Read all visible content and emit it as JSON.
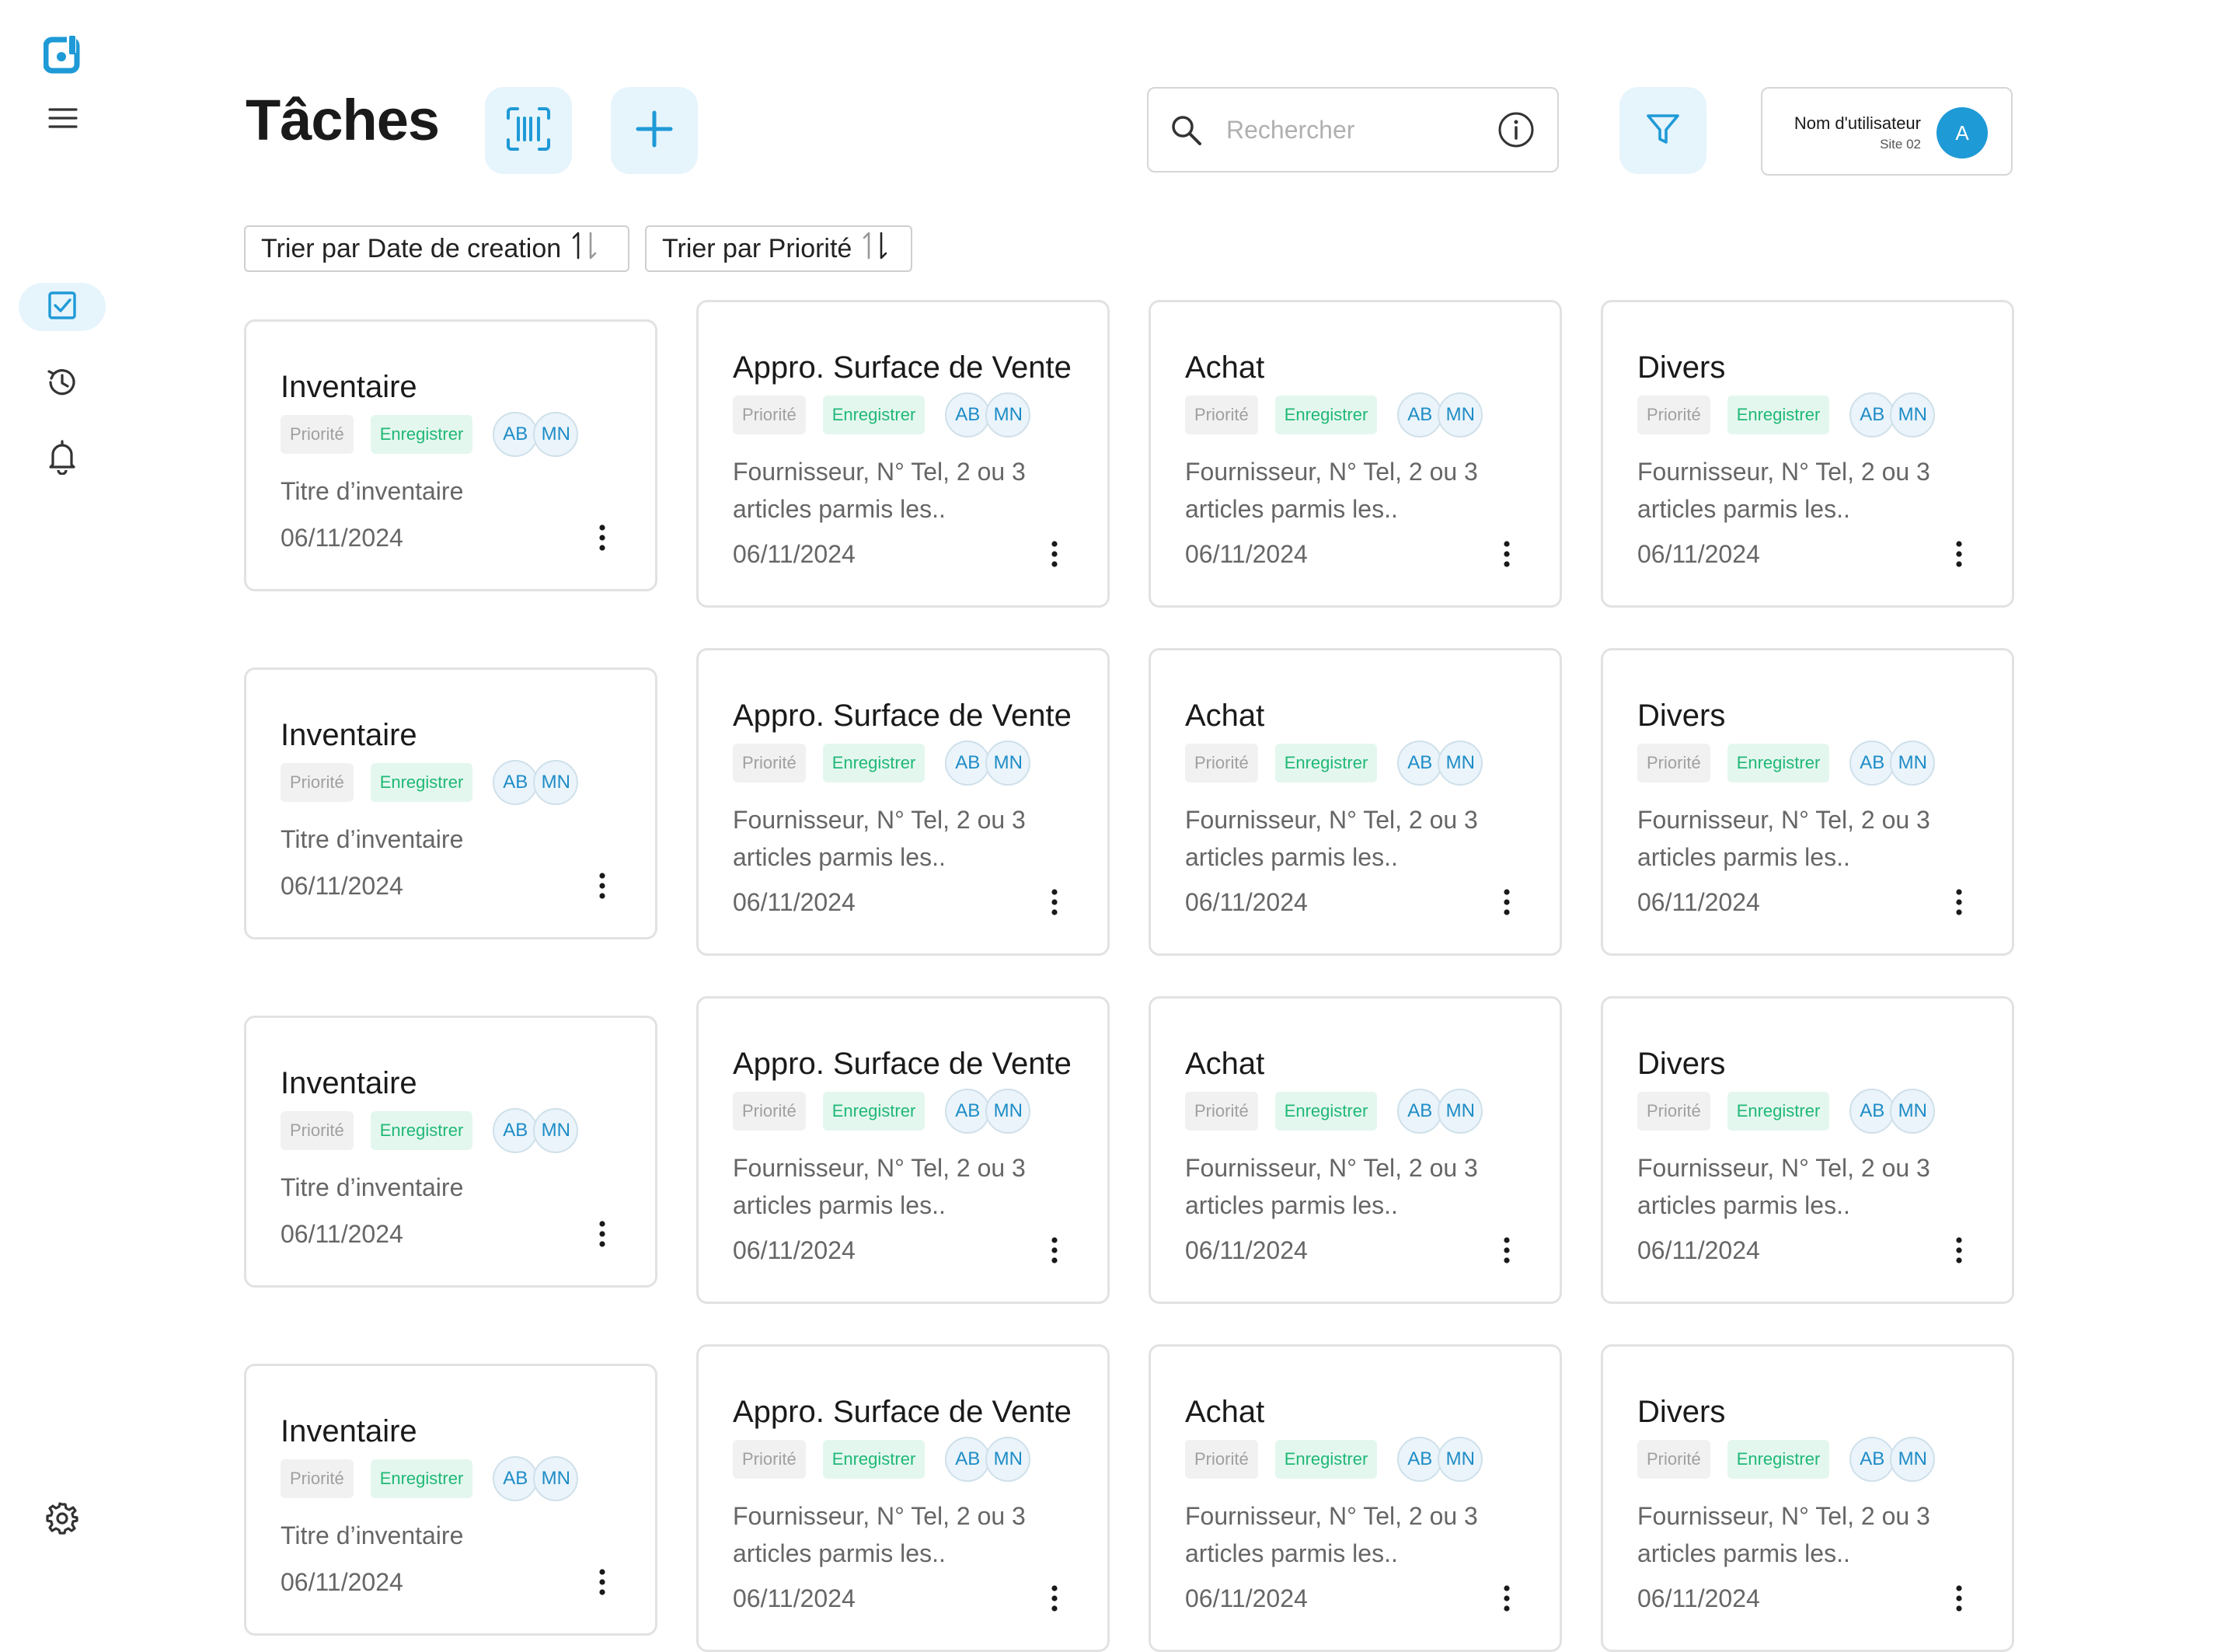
{
  "page": {
    "title": "Tâches"
  },
  "search": {
    "placeholder": "Rechercher"
  },
  "user": {
    "name": "Nom d'utilisateur",
    "site": "Site 02",
    "initial": "A"
  },
  "sort": {
    "by_date": "Trier par Date de creation",
    "by_priority": "Trier par Priorité"
  },
  "nav": {
    "icons": [
      "logo-icon",
      "menu-icon",
      "tasks-icon",
      "history-icon",
      "bell-icon",
      "gear-icon"
    ],
    "active": "tasks",
    "accent": "#1e9ad6"
  },
  "cards": {
    "inventaire": {
      "title": "Inventaire",
      "priority": "Priorité",
      "status": "Enregistrer",
      "assignees": [
        "AB",
        "MN"
      ],
      "desc": "Titre d’inventaire",
      "date": "06/11/2024"
    },
    "appro": {
      "title": "Appro. Surface de Vente",
      "priority": "Priorité",
      "status": "Enregistrer",
      "assignees": [
        "AB",
        "MN"
      ],
      "desc": "Fournisseur, N° Tel, 2 ou 3 articles parmis les..",
      "date": "06/11/2024"
    },
    "achat": {
      "title": "Achat",
      "priority": "Priorité",
      "status": "Enregistrer",
      "assignees": [
        "AB",
        "MN"
      ],
      "desc": "Fournisseur, N° Tel, 2 ou 3 articles parmis les..",
      "date": "06/11/2024"
    },
    "divers": {
      "title": "Divers",
      "priority": "Priorité",
      "status": "Enregistrer",
      "assignees": [
        "AB",
        "MN"
      ],
      "desc": "Fournisseur, N° Tel, 2 ou 3 articles parmis les..",
      "date": "06/11/2024"
    }
  },
  "grid": {
    "rows": 4,
    "columns": [
      "inventaire",
      "appro",
      "achat",
      "divers"
    ]
  },
  "colors": {
    "primary": "#1e9ad6",
    "primary_light": "#e6f4fc",
    "status_green": "#1fb877",
    "border": "#e2e2e2"
  }
}
